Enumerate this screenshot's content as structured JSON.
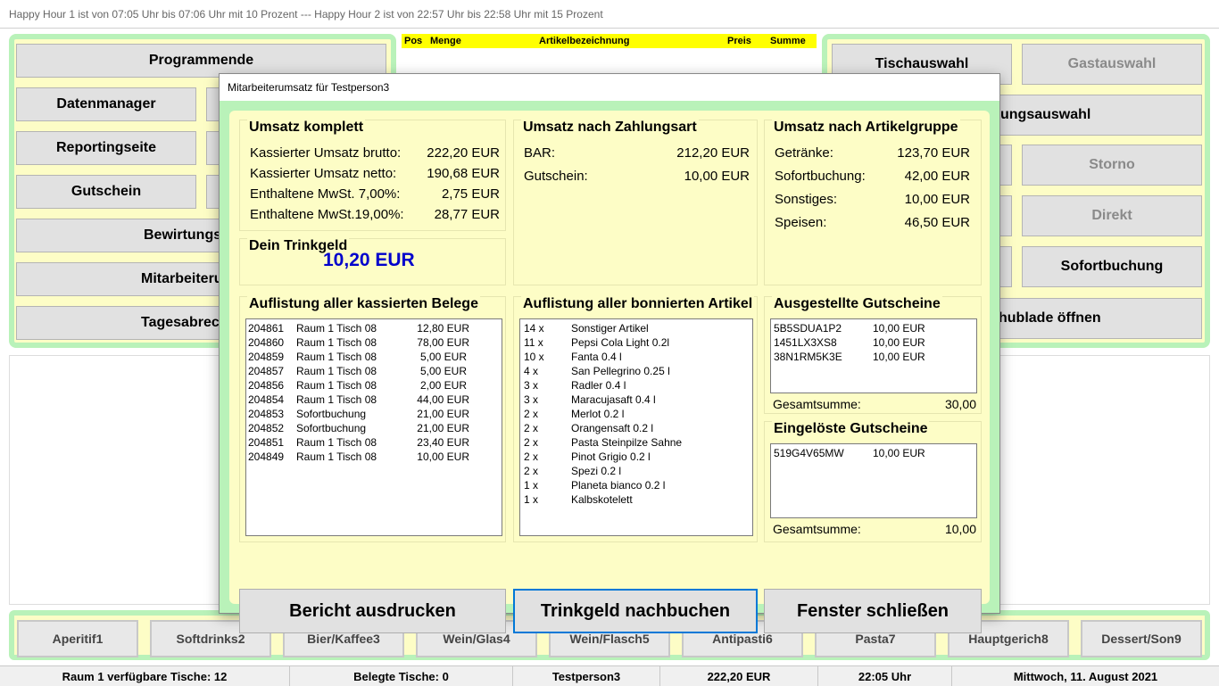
{
  "topbar": {
    "text": "Happy Hour 1 ist von 07:05 Uhr bis 07:06 Uhr mit 10 Prozent --- Happy Hour 2 ist von 22:57 Uhr bis 22:58 Uhr mit 15 Prozent"
  },
  "left_menu": {
    "programmende": "Programmende",
    "datenmanager": "Datenmanager",
    "reportingseite": "Reportingseite",
    "gutschein": "Gutschein",
    "bewirtung": "Bewirtungs",
    "mitarbeiter": "Mitarbeiteru",
    "tagesabrechnung": "Tagesabrec"
  },
  "order": {
    "col_pos": "Pos",
    "col_menge": "Menge",
    "col_artikel": "Artikelbezeichnung",
    "col_preis": "Preis",
    "col_summe": "Summe"
  },
  "right_menu": {
    "tischauswahl": "Tischauswahl",
    "gastauswahl": "Gastauswahl",
    "zahlungsauswahl": "ungsauswahl",
    "storno": "Storno",
    "direkt": "Direkt",
    "sofortbuchung": "Sofortbuchung",
    "schublade": "hublade öffnen"
  },
  "dialog": {
    "title": "Mitarbeiterumsatz für Testperson3",
    "umsatz_komplett": {
      "title": "Umsatz komplett",
      "rows": [
        {
          "label": "Kassierter Umsatz brutto:",
          "value": "222,20 EUR"
        },
        {
          "label": "Kassierter Umsatz netto:",
          "value": "190,68 EUR"
        },
        {
          "label": "Enthaltene MwSt. 7,00%:",
          "value": "2,75 EUR"
        },
        {
          "label": "Enthaltene MwSt.19,00%:",
          "value": "28,77 EUR"
        }
      ]
    },
    "zahlungsart": {
      "title": "Umsatz nach Zahlungsart",
      "rows": [
        {
          "label": "BAR:",
          "value": "212,20 EUR"
        },
        {
          "label": "Gutschein:",
          "value": "10,00 EUR"
        }
      ]
    },
    "artikelgruppe": {
      "title": "Umsatz nach Artikelgruppe",
      "rows": [
        {
          "label": "Getränke:",
          "value": "123,70 EUR"
        },
        {
          "label": "Sofortbuchung:",
          "value": "42,00 EUR"
        },
        {
          "label": "Sonstiges:",
          "value": "10,00 EUR"
        },
        {
          "label": "Speisen:",
          "value": "46,50 EUR"
        }
      ]
    },
    "trinkgeld": {
      "title": "Dein Trinkgeld",
      "value": "10,20 EUR",
      "value_color": "#0000cc"
    },
    "belege": {
      "title": "Auflistung aller kassierten Belege",
      "rows": [
        {
          "nr": "204861",
          "ort": "Raum 1 Tisch 08",
          "betrag": "12,80 EUR"
        },
        {
          "nr": "204860",
          "ort": "Raum 1 Tisch 08",
          "betrag": "78,00 EUR"
        },
        {
          "nr": "204859",
          "ort": "Raum 1 Tisch 08",
          "betrag": "5,00 EUR"
        },
        {
          "nr": "204857",
          "ort": "Raum 1 Tisch 08",
          "betrag": "5,00 EUR"
        },
        {
          "nr": "204856",
          "ort": "Raum 1 Tisch 08",
          "betrag": "2,00 EUR"
        },
        {
          "nr": "204854",
          "ort": "Raum 1 Tisch 08",
          "betrag": "44,00 EUR"
        },
        {
          "nr": "204853",
          "ort": "Sofortbuchung",
          "betrag": "21,00 EUR"
        },
        {
          "nr": "204852",
          "ort": "Sofortbuchung",
          "betrag": "21,00 EUR"
        },
        {
          "nr": "204851",
          "ort": "Raum 1 Tisch 08",
          "betrag": "23,40 EUR"
        },
        {
          "nr": "204849",
          "ort": "Raum 1 Tisch 08",
          "betrag": "10,00 EUR"
        }
      ]
    },
    "artikel": {
      "title": "Auflistung aller bonnierten Artikel",
      "rows": [
        {
          "menge": "14 x",
          "name": "Sonstiger Artikel"
        },
        {
          "menge": "11 x",
          "name": "Pepsi Cola Light 0.2l"
        },
        {
          "menge": "10 x",
          "name": "Fanta 0.4 l"
        },
        {
          "menge": "4 x",
          "name": "San Pellegrino 0.25 l"
        },
        {
          "menge": "3 x",
          "name": "Radler 0.4 l"
        },
        {
          "menge": "3 x",
          "name": "Maracujasaft 0.4 l"
        },
        {
          "menge": "2 x",
          "name": "Merlot 0.2 l"
        },
        {
          "menge": "2 x",
          "name": "Orangensaft 0.2 l"
        },
        {
          "menge": "2 x",
          "name": "Pasta Steinpilze Sahne"
        },
        {
          "menge": "2 x",
          "name": "Pinot Grigio 0.2 l"
        },
        {
          "menge": "2 x",
          "name": "Spezi 0.2 l"
        },
        {
          "menge": "1 x",
          "name": "Planeta bianco 0.2 l"
        },
        {
          "menge": "1 x",
          "name": "Kalbskotelett"
        }
      ]
    },
    "ausgestellt": {
      "title": "Ausgestellte Gutscheine",
      "rows": [
        {
          "code": "5B5SDUA1P2",
          "betrag": "10,00 EUR"
        },
        {
          "code": "1451LX3XS8",
          "betrag": "10,00 EUR"
        },
        {
          "code": "38N1RM5K3E",
          "betrag": "10,00 EUR"
        }
      ],
      "sum_label": "Gesamtsumme:",
      "sum_value": "30,00"
    },
    "eingeloest": {
      "title": "Eingelöste Gutscheine",
      "rows": [
        {
          "code": "519G4V65MW",
          "betrag": "10,00 EUR"
        }
      ],
      "sum_label": "Gesamtsumme:",
      "sum_value": "10,00"
    },
    "buttons": {
      "bericht": "Bericht ausdrucken",
      "trinkgeld": "Trinkgeld nachbuchen",
      "schliessen": "Fenster schließen"
    }
  },
  "categories": [
    "Aperitif1",
    "Softdrinks2",
    "Bier/Kaffee3",
    "Wein/Glas4",
    "Wein/Flasch5",
    "Antipasti6",
    "Pasta7",
    "Hauptgerich8",
    "Dessert/Son9"
  ],
  "status": {
    "raum": "Raum 1 verfügbare Tische: 12",
    "belegt": "Belegte Tische: 0",
    "person": "Testperson3",
    "umsatz": "222,20 EUR",
    "uhrzeit": "22:05 Uhr",
    "datum": "Mittwoch, 11. August 2021"
  }
}
